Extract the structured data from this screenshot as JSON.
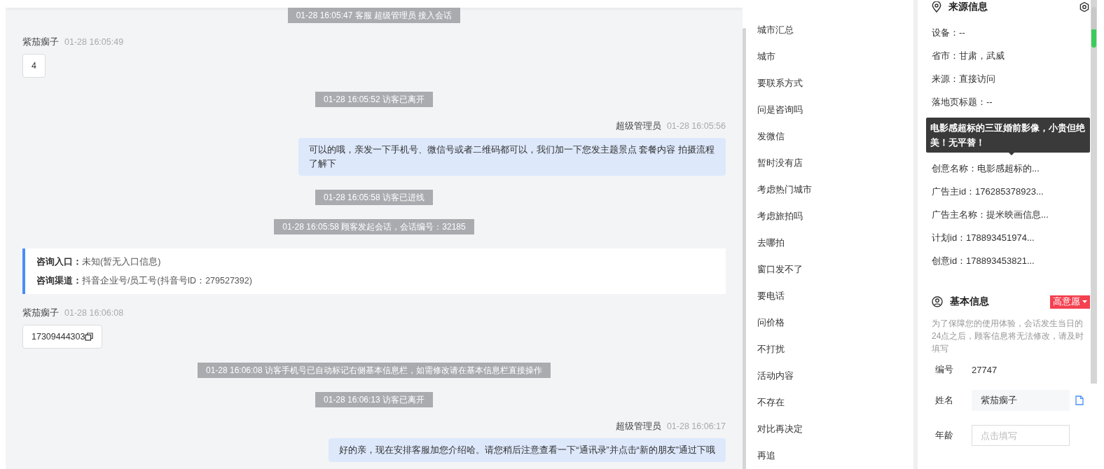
{
  "chat": {
    "messages": [
      {
        "kind": "system",
        "text": "01-28 16:05:47 客服 超级管理员 接入会话"
      },
      {
        "kind": "visitor",
        "sender": "紫茄瘸子",
        "time": "01-28 16:05:49",
        "text": "4",
        "has_copy": false
      },
      {
        "kind": "system",
        "text": "01-28 16:05:52 访客已离开"
      },
      {
        "kind": "agent",
        "sender": "超级管理员",
        "time": "01-28 16:05:56",
        "text": "可以的哦，亲发一下手机号、微信号或者二维码都可以，我们加一下您发主题景点 套餐内容 拍摄流程了解下"
      },
      {
        "kind": "system",
        "text": "01-28 16:05:58 访客已进线"
      },
      {
        "kind": "system",
        "text": "01-28 16:05:58 顾客发起会话，会话编号：32185"
      },
      {
        "kind": "entry_card",
        "rows": [
          {
            "label": "咨询入口：",
            "value": "未知(暂无入口信息)"
          },
          {
            "label": "咨询渠道：",
            "value": "抖音企业号/员工号(抖音号ID：279527392)"
          }
        ]
      },
      {
        "kind": "visitor",
        "sender": "紫茄瘸子",
        "time": "01-28 16:06:08",
        "text": "17309444303",
        "has_copy": true
      },
      {
        "kind": "system",
        "text": "01-28 16:06:08 访客手机号已自动标记右侧基本信息栏，如需修改请在基本信息栏直接操作"
      },
      {
        "kind": "system",
        "text": "01-28 16:06:13 访客已离开"
      },
      {
        "kind": "agent",
        "sender": "超级管理员",
        "time": "01-28 16:06:17",
        "text": "好的亲，现在安排客服加您介绍哈。请您稍后注意查看一下“通讯录”并点击“新的朋友”通过下哦"
      }
    ]
  },
  "phrases": [
    "城市汇总",
    "城市",
    "要联系方式",
    "问是咨询吗",
    "发微信",
    "暂时没有店",
    "考虑热门城市",
    "考虑旅拍吗",
    "去哪拍",
    "窗口发不了",
    "要电话",
    "问价格",
    "不打扰",
    "活动内容",
    "不存在",
    "对比再决定",
    "再追"
  ],
  "source_info": {
    "title": "来源信息",
    "rows": [
      {
        "kind": "field",
        "text": "设备：--"
      },
      {
        "kind": "field",
        "text": "省市：甘肃，武威"
      },
      {
        "kind": "field",
        "text": "来源：直接访问"
      },
      {
        "kind": "field",
        "text": "落地页标题：--"
      },
      {
        "kind": "tooltip",
        "text": "电影感超标的三亚婚前影像，小贵但绝美！无平替！"
      },
      {
        "kind": "field",
        "text": "创意名称：电影感超标的..."
      },
      {
        "kind": "field",
        "text": "广告主id：176285378923..."
      },
      {
        "kind": "field",
        "text": "广告主名称：提米映画信息..."
      },
      {
        "kind": "field",
        "text": "计划id：178893451974..."
      },
      {
        "kind": "field",
        "text": "创意id：178893453821..."
      }
    ]
  },
  "basic_info": {
    "title": "基本信息",
    "tag": "高意愿",
    "notice": "为了保障您的使用体验，会话发生当日的24点之后，顾客信息将无法修改，请及时填写",
    "fields": [
      {
        "kind": "text",
        "label": "编号",
        "value": "27747"
      },
      {
        "kind": "input",
        "label": "姓名",
        "value": "紫茄瘸子"
      },
      {
        "kind": "input",
        "label": "年龄",
        "placeholder": "点击填写"
      }
    ]
  }
}
